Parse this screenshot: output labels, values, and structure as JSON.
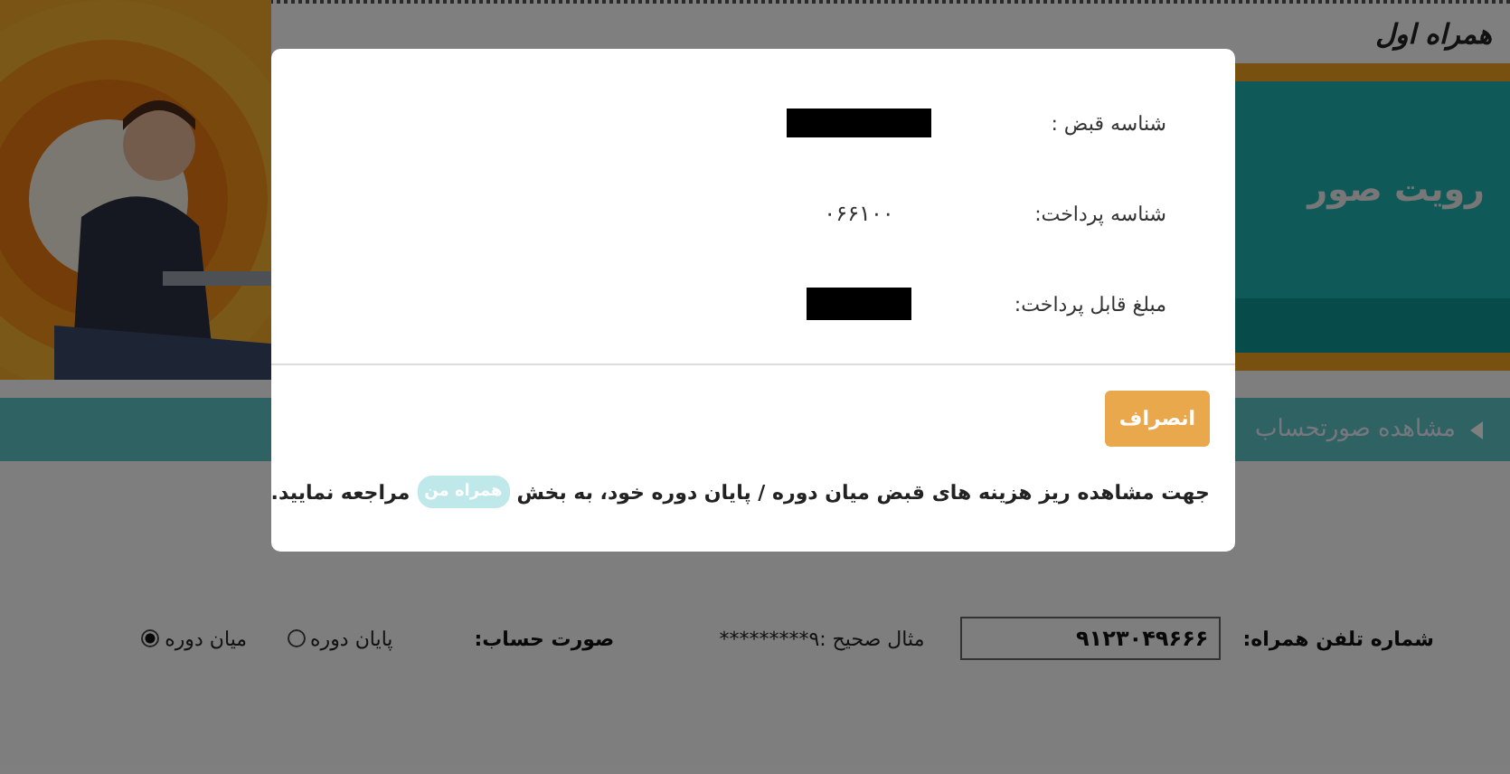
{
  "header": {
    "logo": "همراه اول"
  },
  "banner": {
    "title": "رویت صور"
  },
  "breadcrumb": {
    "label": "مشاهده صورتحساب"
  },
  "form": {
    "phone_label": "شماره تلفن همراه:",
    "phone_value": "۹۱۲۳۰۴۹۶۶۶",
    "phone_hint": "مثال صحیح :۹*********",
    "bill_label": "صورت حساب:",
    "bill_options": [
      {
        "label": "پایان دوره",
        "selected": false
      },
      {
        "label": "میان دوره",
        "selected": true
      }
    ]
  },
  "dialog": {
    "fields": [
      {
        "label": "شناسه قبض :",
        "redacted": true
      },
      {
        "label": "شناسه پرداخت:",
        "value": "۰۶۶۱۰۰",
        "redacted": false
      },
      {
        "label": "مبلغ قابل پرداخت:",
        "redacted": true
      }
    ],
    "cancel_button": "انصراف",
    "note_before": "جهت مشاهده ریز هزینه های قبض میان دوره / پایان دوره خود، به بخش",
    "note_logo": "همراه من",
    "note_after": "مراجعه نمایید."
  }
}
